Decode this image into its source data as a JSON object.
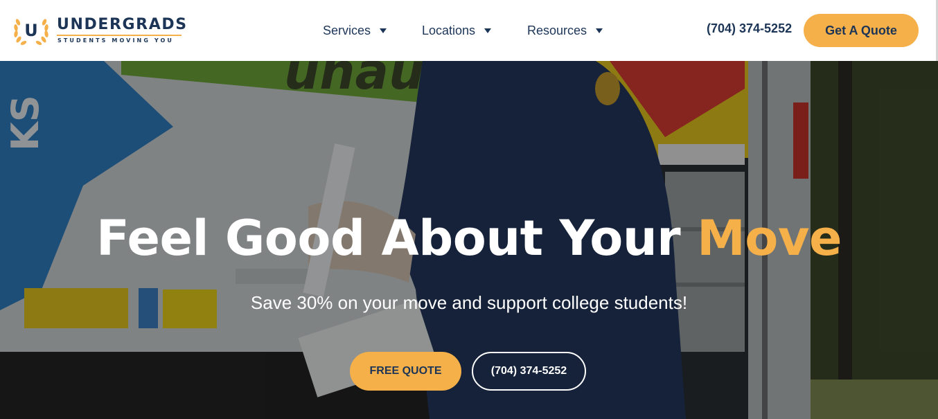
{
  "brand": {
    "name": "UNDERGRADS",
    "tagline": "STUDENTS MOVING YOU",
    "monogram": "U",
    "colors": {
      "navy": "#1c3557",
      "gold": "#f5b04a"
    }
  },
  "nav": {
    "items": [
      {
        "label": "Services",
        "icon": "caret-down-icon"
      },
      {
        "label": "Locations",
        "icon": "caret-down-icon"
      },
      {
        "label": "Resources",
        "icon": "caret-down-icon"
      }
    ]
  },
  "header": {
    "phone": "(704) 374-5252",
    "cta_label": "Get A Quote"
  },
  "hero": {
    "title_main": "Feel Good About Your ",
    "title_accent": "Move",
    "subtitle": "Save 30% on your move and support college students!",
    "primary_button": "FREE QUOTE",
    "secondary_button": "(704) 374-5252",
    "truck_lettering": "uhaul.co"
  }
}
